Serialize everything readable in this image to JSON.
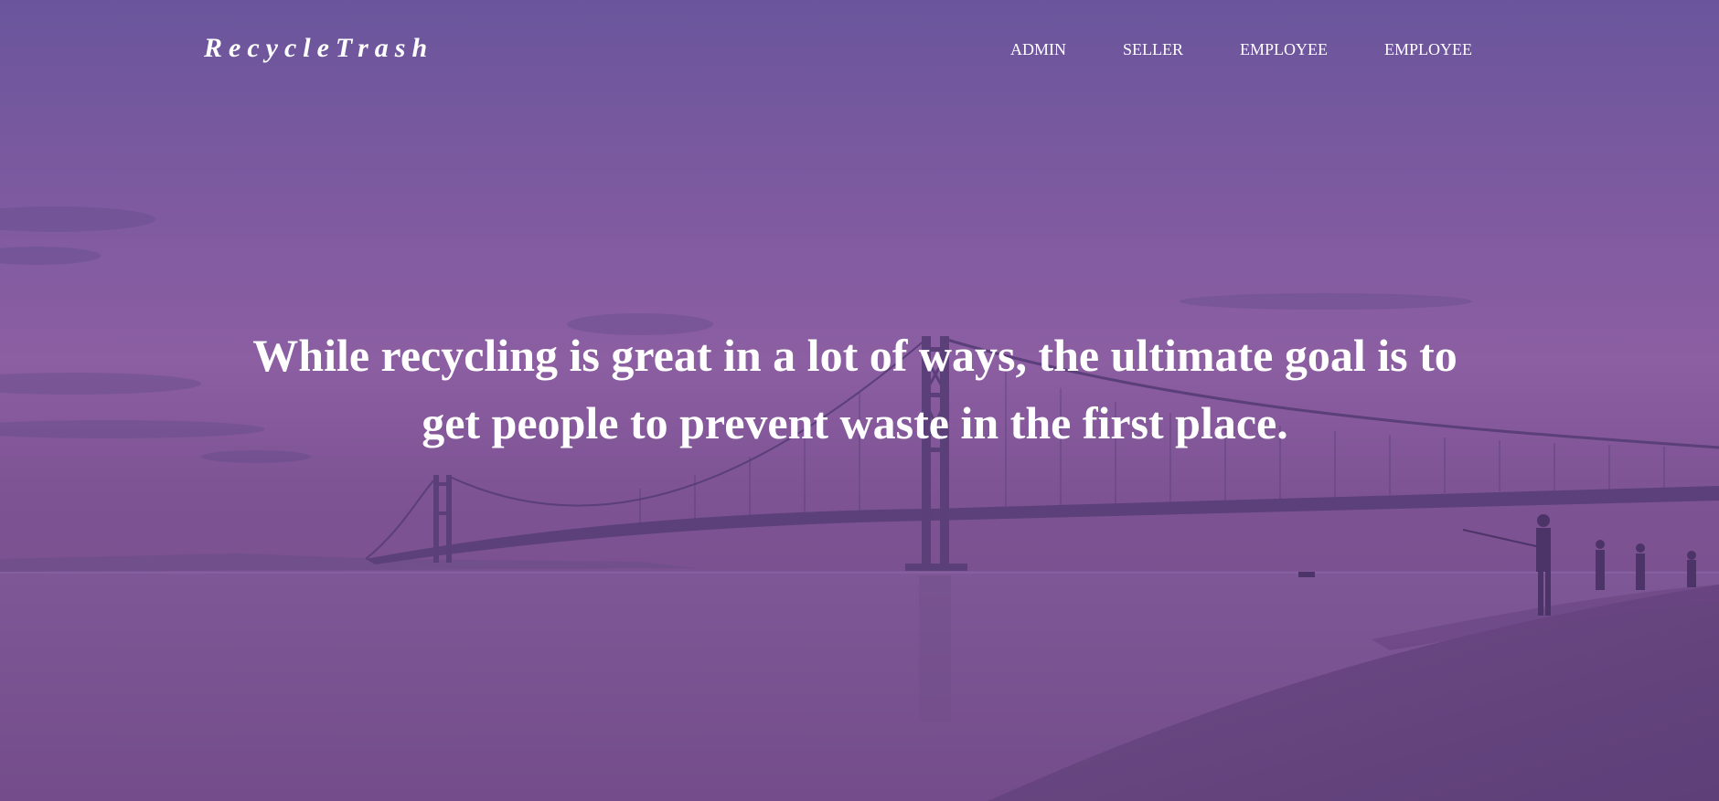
{
  "brand": {
    "name": "RecycleTrash"
  },
  "nav": {
    "items": [
      {
        "label": "ADMIN"
      },
      {
        "label": "SELLER"
      },
      {
        "label": "EMPLOYEE"
      },
      {
        "label": "EMPLOYEE"
      }
    ]
  },
  "hero": {
    "headline": "While recycling is great in a lot of ways, the ultimate goal is to get people to prevent waste in the first place.",
    "overlay_color": "#7b5296",
    "background_image": "suspension-bridge-over-water-with-people-fishing-on-shore"
  }
}
